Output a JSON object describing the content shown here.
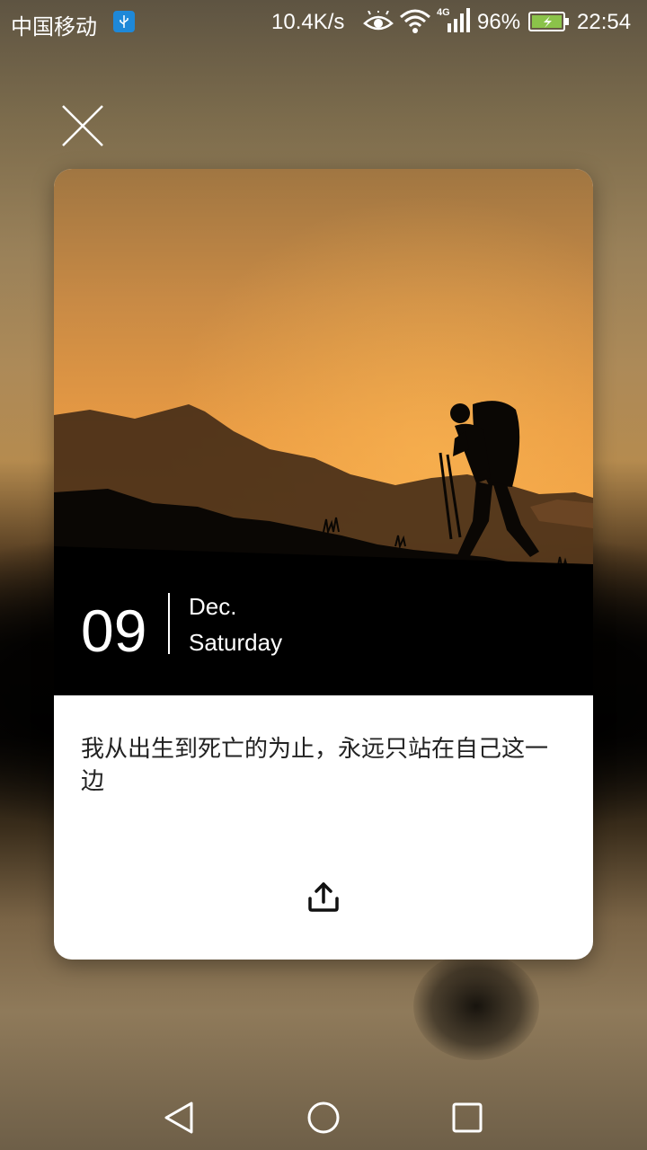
{
  "status_bar": {
    "carrier": "中国移动",
    "net_speed": "10.4K/s",
    "network_type": "4G",
    "battery_percent": "96%",
    "time": "22:54",
    "icons": [
      "usb-icon",
      "eye-icon",
      "wifi-icon",
      "signal-icon",
      "battery-charging-icon"
    ]
  },
  "card": {
    "day": "09",
    "month": "Dec.",
    "weekday": "Saturday",
    "quote": "我从出生到死亡的为止，永远只站在自己这一边",
    "photo_subject": "hiker-silhouette-sunset"
  },
  "actions": {
    "close_icon": "close-icon",
    "share_icon": "share-icon"
  },
  "nav_bar": {
    "icons": [
      "back-icon",
      "home-icon",
      "recents-icon"
    ]
  },
  "colors": {
    "sky_top": "#b07a3a",
    "sky_glow": "#f5a745",
    "card_background": "#ffffff",
    "quote_text": "#222222",
    "battery_fill": "#8bc34a"
  }
}
